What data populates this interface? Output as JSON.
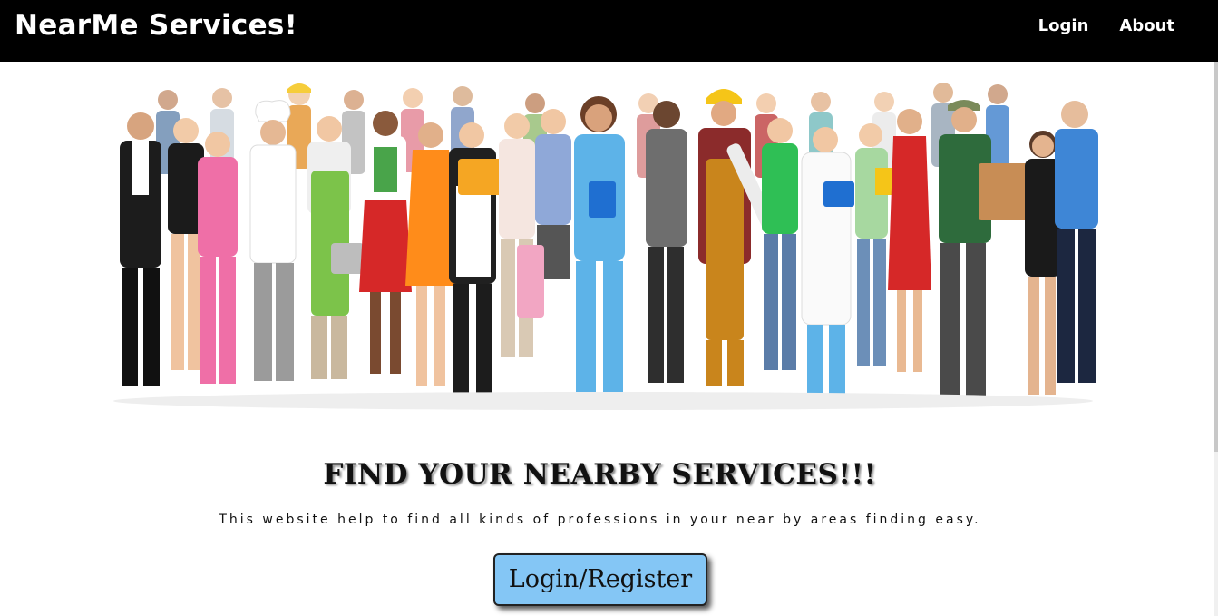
{
  "navbar": {
    "brand": "NearMe Services!",
    "links": [
      {
        "label": "Login"
      },
      {
        "label": "About"
      }
    ]
  },
  "hero": {
    "image_description": "group-of-professionals-photo"
  },
  "main": {
    "headline": "FIND YOUR NEARBY SERVICES!!!",
    "tagline": "This website help to find all kinds of professions in your near by areas finding easy.",
    "cta_label": "Login/Register"
  },
  "colors": {
    "navbar_bg": "#000000",
    "cta_bg": "#84c6f5",
    "page_bg": "#ffffff"
  }
}
